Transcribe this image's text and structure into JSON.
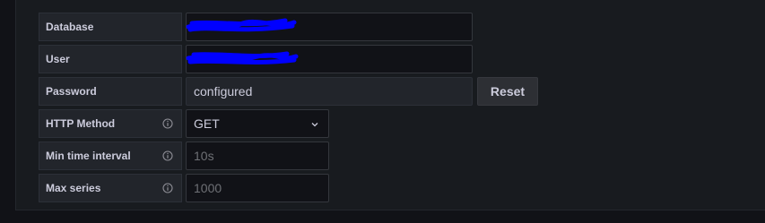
{
  "settings": {
    "database": {
      "label": "Database",
      "value": "",
      "redacted": true
    },
    "user": {
      "label": "User",
      "value": "",
      "redacted": true
    },
    "password": {
      "label": "Password",
      "value": "configured",
      "reset_label": "Reset"
    },
    "http_method": {
      "label": "HTTP Method",
      "value": "GET",
      "icon": "info-icon"
    },
    "min_time_interval": {
      "label": "Min time interval",
      "placeholder": "10s",
      "icon": "info-icon"
    },
    "max_series": {
      "label": "Max series",
      "placeholder": "1000",
      "icon": "info-icon"
    }
  },
  "colors": {
    "background": "#111217",
    "panel": "#181b1f",
    "label_bg": "#22252b",
    "text": "#ccccdc",
    "redaction": "#0000ff"
  }
}
